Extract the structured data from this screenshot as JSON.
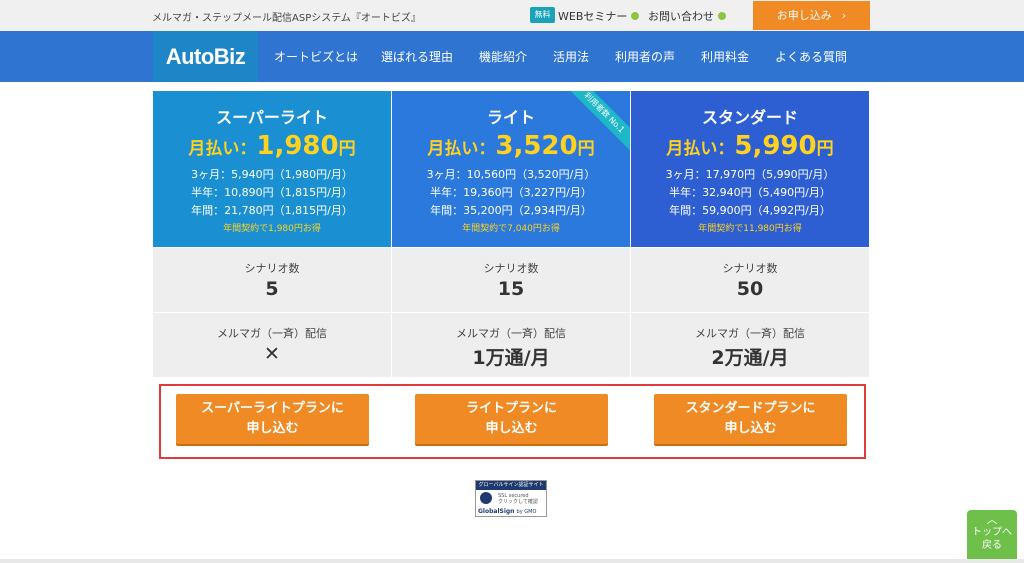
{
  "topbar": {
    "tagline": "メルマガ・ステップメール配信ASPシステム『オートビズ』",
    "free_badge": "無料",
    "webinar": "WEBセミナー",
    "contact": "お問い合わせ",
    "apply": "お申し込み"
  },
  "nav": {
    "logo": "AutoBiz",
    "items": [
      "オートビズとは",
      "選ばれる理由",
      "機能紹介",
      "活用法",
      "利用者の声",
      "利用料金",
      "よくある質問"
    ]
  },
  "colors": {
    "super_light": "#1a90d2",
    "light": "#2b79dc",
    "standard": "#2e5fd2",
    "accent_orange": "#f08a24",
    "highlight_box": "#e03a3a"
  },
  "plans": [
    {
      "name": "スーパーライト",
      "monthly_label": "月払い：",
      "monthly_price": "1,980",
      "yen": "円",
      "term_3m": "3ヶ月：5,940円（1,980円/月）",
      "term_6m": "半年：10,890円（1,815円/月）",
      "term_1y": "年間：21,780円（1,815円/月）",
      "saving": "年間契約で1,980円お得",
      "scenario_label": "シナリオ数",
      "scenario_value": "5",
      "mail_label": "メルマガ（一斉）配信",
      "mail_value": "✕",
      "apply_line1": "スーパーライトプランに",
      "apply_line2": "申し込む"
    },
    {
      "name": "ライト",
      "ribbon": "利用者数 No.1",
      "monthly_label": "月払い：",
      "monthly_price": "3,520",
      "yen": "円",
      "term_3m": "3ヶ月：10,560円（3,520円/月）",
      "term_6m": "半年：19,360円（3,227円/月）",
      "term_1y": "年間：35,200円（2,934円/月）",
      "saving": "年間契約で7,040円お得",
      "scenario_label": "シナリオ数",
      "scenario_value": "15",
      "mail_label": "メルマガ（一斉）配信",
      "mail_value": "1万通/月",
      "apply_line1": "ライトプランに",
      "apply_line2": "申し込む"
    },
    {
      "name": "スタンダード",
      "monthly_label": "月払い：",
      "monthly_price": "5,990",
      "yen": "円",
      "term_3m": "3ヶ月：17,970円（5,990円/月）",
      "term_6m": "半年：32,940円（5,490円/月）",
      "term_1y": "年間：59,900円（4,992円/月）",
      "saving": "年間契約で11,980円お得",
      "scenario_label": "シナリオ数",
      "scenario_value": "50",
      "mail_label": "メルマガ（一斉）配信",
      "mail_value": "2万通/月",
      "apply_line1": "スタンダードプランに",
      "apply_line2": "申し込む"
    }
  ],
  "globalsign": {
    "band": "グローバルサイン認証サイト",
    "ssl": "SSL secured",
    "click": "クリックして確認",
    "brand": "GlobalSign",
    "by": "by GMO"
  },
  "to_top": {
    "line1": "トップへ",
    "line2": "戻る"
  }
}
